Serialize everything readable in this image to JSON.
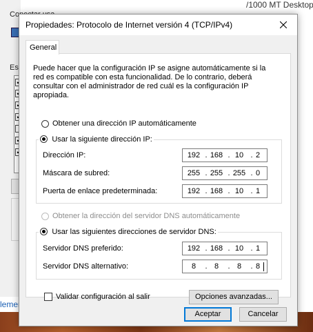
{
  "background": {
    "title_fragment": "/1000 MT Desktop",
    "conectar_label": "Conectar usa",
    "est_label": "Est",
    "bottom_link": "lemen"
  },
  "dialog": {
    "title": "Propiedades: Protocolo de Internet versión 4 (TCP/IPv4)",
    "close_icon": "close-icon",
    "tab_label": "General",
    "description": "Puede hacer que la configuración IP se asigne automáticamente si la red es compatible con esta funcionalidad. De lo contrario, deberá consultar con el administrador de red cuál es la configuración IP apropiada.",
    "ip_auto_label": "Obtener una dirección IP automáticamente",
    "ip_manual_label": "Usar la siguiente dirección IP:",
    "ip_fields": [
      {
        "label": "Dirección IP:",
        "octets": [
          "192",
          "168",
          "10",
          "2"
        ]
      },
      {
        "label": "Máscara de subred:",
        "octets": [
          "255",
          "255",
          "255",
          "0"
        ]
      },
      {
        "label": "Puerta de enlace predeterminada:",
        "octets": [
          "192",
          "168",
          "10",
          "1"
        ]
      }
    ],
    "dns_auto_label": "Obtener la dirección del servidor DNS automáticamente",
    "dns_manual_label": "Usar las siguientes direcciones de servidor DNS:",
    "dns_fields": [
      {
        "label": "Servidor DNS preferido:",
        "octets": [
          "192",
          "168",
          "10",
          "1"
        ]
      },
      {
        "label": "Servidor DNS alternativo:",
        "octets": [
          "8",
          "8",
          "8",
          "8"
        ]
      }
    ],
    "validate_label": "Validar configuración al salir",
    "advanced_button": "Opciones avanzadas...",
    "accept_button": "Aceptar",
    "cancel_button": "Cancelar",
    "ip_mode": "manual",
    "dns_mode": "manual",
    "validate_checked": false
  },
  "colors": {
    "default_button_border": "#0078d7",
    "dialog_bg": "#f0f0f0"
  }
}
